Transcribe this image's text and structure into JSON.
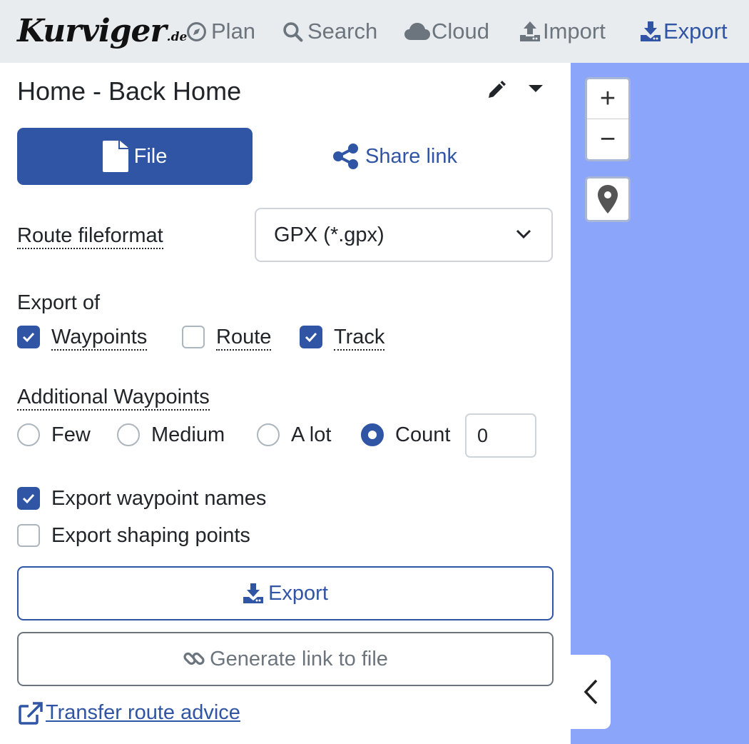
{
  "navbar": {
    "logo_text": "Kurviger",
    "logo_tld": ".de",
    "items": [
      {
        "label": "Plan",
        "icon": "compass-icon",
        "active": false
      },
      {
        "label": "Search",
        "icon": "search-icon",
        "active": false
      },
      {
        "label": "Cloud",
        "icon": "cloud-icon",
        "active": false
      },
      {
        "label": "Import",
        "icon": "upload-icon",
        "active": false
      },
      {
        "label": "Export",
        "icon": "download-icon",
        "active": true
      }
    ]
  },
  "panel": {
    "title": "Home - Back Home",
    "title_actions": [
      "pencil-icon",
      "caret-down-icon"
    ],
    "tabs": {
      "file_label": "File",
      "share_label": "Share link"
    },
    "fileformat": {
      "label": "Route fileformat",
      "selected": "GPX (*.gpx)"
    },
    "export_of": {
      "label": "Export of",
      "options": [
        {
          "label": "Waypoints",
          "checked": true
        },
        {
          "label": "Route",
          "checked": false
        },
        {
          "label": "Track",
          "checked": true
        }
      ]
    },
    "additional_waypoints": {
      "label": "Additional Waypoints",
      "options": [
        {
          "label": "Few",
          "selected": false
        },
        {
          "label": "Medium",
          "selected": false
        },
        {
          "label": "A lot",
          "selected": false
        },
        {
          "label": "Count",
          "selected": true
        }
      ],
      "count_value": "0"
    },
    "export_waypoint_names": {
      "label": "Export waypoint names",
      "checked": true
    },
    "export_shaping_points": {
      "label": "Export shaping points",
      "checked": false
    },
    "export_button": "Export",
    "generate_link_button": "Generate link to file",
    "transfer_link": "Transfer route advice"
  },
  "map": {
    "zoom_in": "+",
    "zoom_out": "−",
    "background_color": "#8aa5fa"
  },
  "colors": {
    "primary": "#2f55a4",
    "navbar_bg": "#e9ecef",
    "muted": "#6c757d"
  }
}
